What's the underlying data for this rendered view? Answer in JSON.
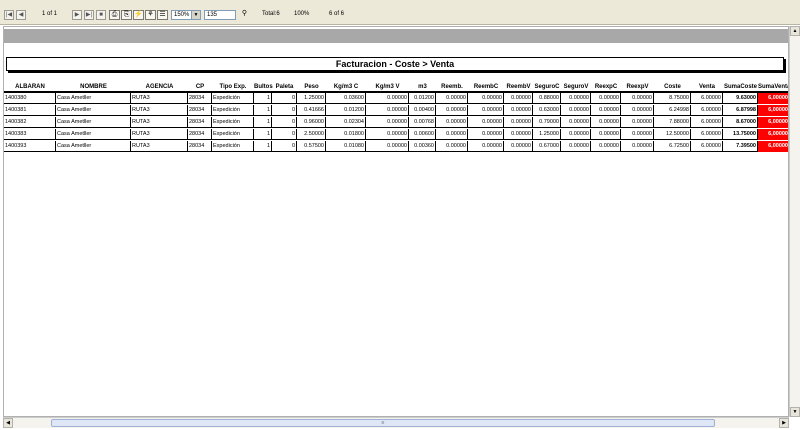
{
  "toolbar": {
    "page_display": "1 of 1",
    "zoom": "150%",
    "search_value": "135",
    "total": "Total:6",
    "percent": "100%",
    "count": "6 of 6"
  },
  "report": {
    "title": "Facturacion - Coste > Venta",
    "columns": [
      "ALBARAN",
      "NOMBRE",
      "AGENCIA",
      "CP",
      "Tipo Exp.",
      "Bultos",
      "Paleta",
      "Peso",
      "Kg/m3 C",
      "Kg/m3 V",
      "m3",
      "Reemb.",
      "ReembC",
      "ReembV",
      "SeguroC",
      "SeguroV",
      "ReexpC",
      "ReexpV",
      "Coste",
      "Venta",
      "SumaCoste",
      "SumaVenta"
    ],
    "rows": [
      [
        "1400380",
        "Casa Ametller",
        "RUTA3",
        "28034",
        "Expedición",
        "1",
        "0",
        "1.25000",
        "0.03600",
        "0.00000",
        "0.01200",
        "0.00000",
        "0.00000",
        "0.00000",
        "0.88000",
        "0.00000",
        "0.00000",
        "0.00000",
        "8.75000",
        "6.00000",
        "9.63000",
        "6,00000"
      ],
      [
        "1400381",
        "Casa Ametller",
        "RUTA3",
        "28034",
        "Expedición",
        "1",
        "0",
        "0.41666",
        "0.01200",
        "0.00000",
        "0.00400",
        "0.00000",
        "0.00000",
        "0.00000",
        "0.63000",
        "0.00000",
        "0.00000",
        "0.00000",
        "6.24998",
        "6.00000",
        "6.87998",
        "6,00000"
      ],
      [
        "1400382",
        "Casa Ametller",
        "RUTA3",
        "28034",
        "Expedición",
        "1",
        "0",
        "0.96000",
        "0.02304",
        "0.00000",
        "0.00768",
        "0.00000",
        "0.00000",
        "0.00000",
        "0.79000",
        "0.00000",
        "0.00000",
        "0.00000",
        "7.88000",
        "6.00000",
        "8.67000",
        "6,00000"
      ],
      [
        "1400383",
        "Casa Ametller",
        "RUTA3",
        "28034",
        "Expedición",
        "1",
        "0",
        "2.50000",
        "0.01800",
        "0.00000",
        "0.00600",
        "0.00000",
        "0.00000",
        "0.00000",
        "1.25000",
        "0.00000",
        "0.00000",
        "0.00000",
        "12.50000",
        "6.00000",
        "13.75000",
        "6,00000"
      ],
      [
        "1400393",
        "Casa Ametller",
        "RUTA3",
        "28034",
        "Expedición",
        "1",
        "0",
        "0.57500",
        "0.01080",
        "0.00000",
        "0.00360",
        "0.00000",
        "0.00000",
        "0.00000",
        "0.67000",
        "0.00000",
        "0.00000",
        "0.00000",
        "6.72500",
        "6.00000",
        "7.39500",
        "6,00000"
      ]
    ]
  },
  "colors": {
    "highlight": "#ff0000",
    "band": "#a8a8a8",
    "toolbar": "#ece9d8"
  },
  "icons": [
    "first-page-icon",
    "prev-page-icon",
    "next-page-icon",
    "last-page-icon",
    "stop-icon",
    "print-icon",
    "print-setup-icon",
    "refresh-icon",
    "tree-icon",
    "group-icon",
    "binoculars-icon"
  ],
  "glyphs": {
    "first": "|◀",
    "prev": "◀",
    "next": "▶",
    "last": "▶|",
    "stop": "■",
    "print": "⎙",
    "setup": "⎘",
    "refresh": "⚡",
    "tree": "⚘",
    "group": "☰",
    "find": "⚲",
    "up": "▲",
    "down": "▼",
    "left": "◀",
    "right": "▶",
    "grip": "≡"
  }
}
